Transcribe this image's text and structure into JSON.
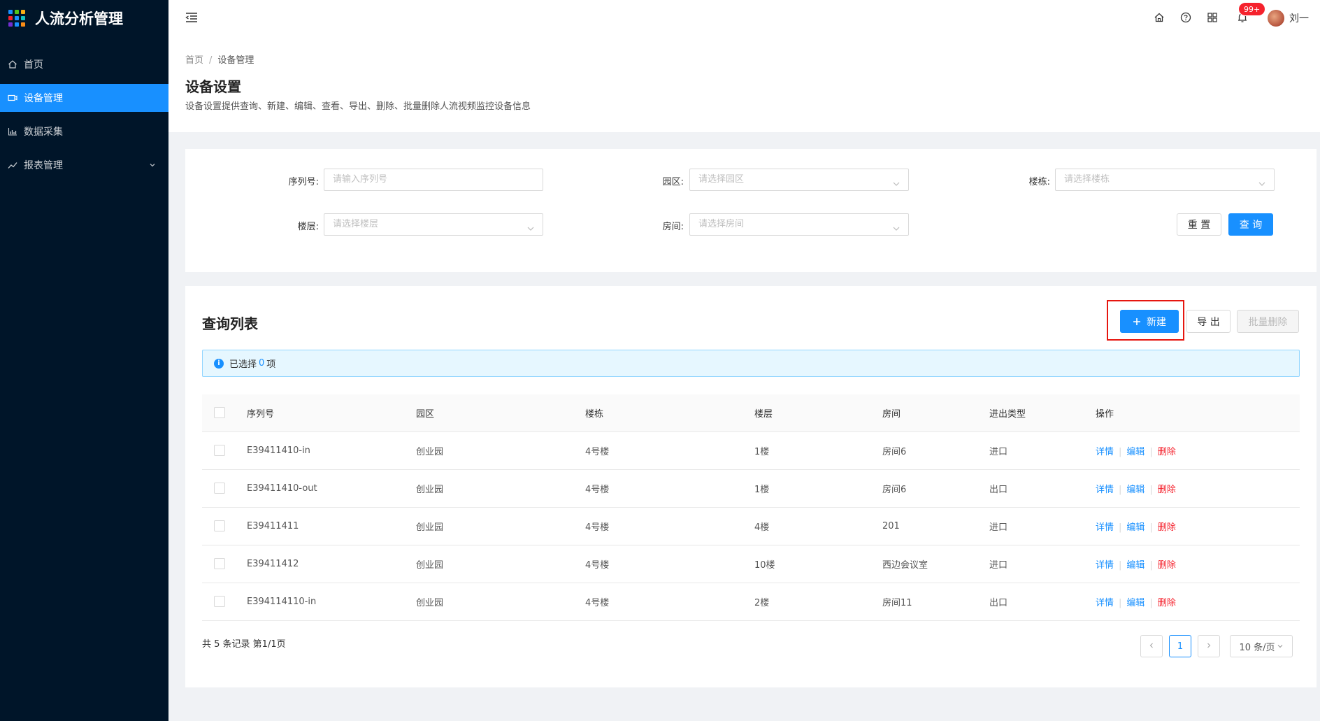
{
  "app": {
    "title": "人流分析管理",
    "logo_colors": [
      "#1890ff",
      "#52c41a",
      "#faad14",
      "#f5222d",
      "#1890ff",
      "#13c2c2",
      "#722ed1",
      "#1890ff",
      "#fa8c16"
    ]
  },
  "sidebar": {
    "items": [
      {
        "label": "首页",
        "icon": "home-icon"
      },
      {
        "label": "设备管理",
        "icon": "camera-icon",
        "active": true
      },
      {
        "label": "数据采集",
        "icon": "bar-chart-icon"
      },
      {
        "label": "报表管理",
        "icon": "line-chart-icon",
        "has_submenu": true
      }
    ]
  },
  "header": {
    "notification_badge": "99+",
    "username": "刘一"
  },
  "breadcrumb": {
    "home": "首页",
    "separator": "/",
    "current": "设备管理"
  },
  "page": {
    "title": "设备设置",
    "description": "设备设置提供查询、新建、编辑、查看、导出、删除、批量删除人流视频监控设备信息"
  },
  "search": {
    "serial_label": "序列号:",
    "serial_placeholder": "请输入序列号",
    "park_label": "园区:",
    "park_placeholder": "请选择园区",
    "building_label": "楼栋:",
    "building_placeholder": "请选择楼栋",
    "floor_label": "楼层:",
    "floor_placeholder": "请选择楼层",
    "room_label": "房间:",
    "room_placeholder": "请选择房间",
    "reset_label": "重 置",
    "query_label": "查 询"
  },
  "list": {
    "title": "查询列表",
    "new_label": "新建",
    "export_label": "导 出",
    "batch_delete_label": "批量删除",
    "selected_prefix": "已选择",
    "selected_count": "0",
    "selected_suffix": "项",
    "columns": [
      "序列号",
      "园区",
      "楼栋",
      "楼层",
      "房间",
      "进出类型",
      "操作"
    ],
    "rows": [
      {
        "serial": "E39411410-in",
        "park": "创业园",
        "building": "4号楼",
        "floor": "1楼",
        "room": "房间6",
        "type": "进口"
      },
      {
        "serial": "E39411410-out",
        "park": "创业园",
        "building": "4号楼",
        "floor": "1楼",
        "room": "房间6",
        "type": "出口"
      },
      {
        "serial": "E39411411",
        "park": "创业园",
        "building": "4号楼",
        "floor": "4楼",
        "room": "201",
        "type": "进口"
      },
      {
        "serial": "E39411412",
        "park": "创业园",
        "building": "4号楼",
        "floor": "10楼",
        "room": "西边会议室",
        "type": "进口"
      },
      {
        "serial": "E394114110-in",
        "park": "创业园",
        "building": "4号楼",
        "floor": "2楼",
        "room": "房间11",
        "type": "出口"
      }
    ],
    "actions": {
      "detail": "详情",
      "edit": "编辑",
      "delete": "删除"
    },
    "total_text": "共 5 条记录 第1/1页",
    "current_page": "1",
    "page_size": "10 条/页"
  }
}
